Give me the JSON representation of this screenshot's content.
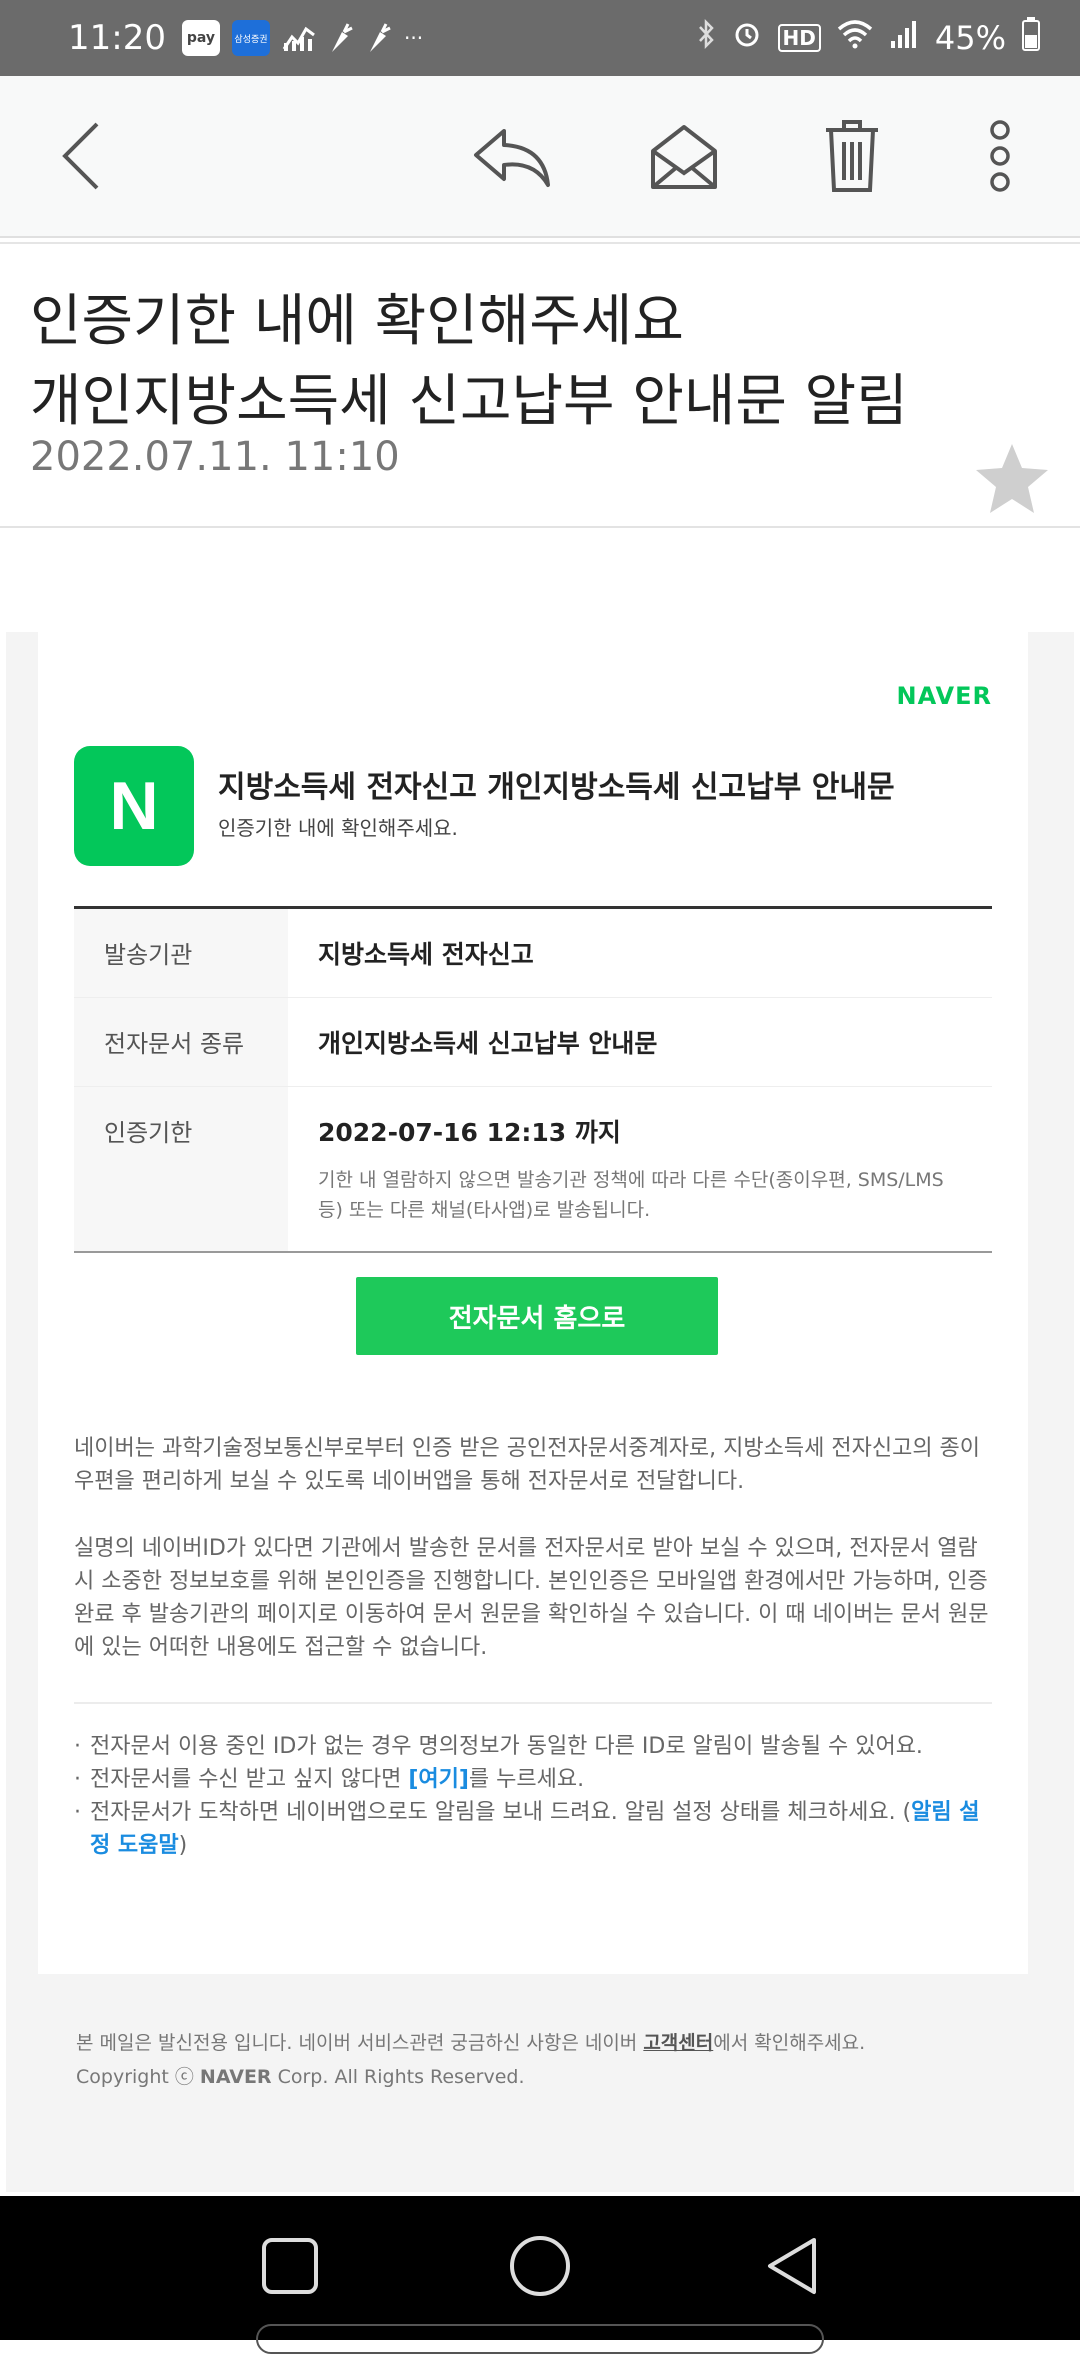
{
  "status_bar": {
    "time": "11:20",
    "pay_label": "pay",
    "samsung_label": "삼성증권",
    "more": "···",
    "battery": "45%",
    "hd_label": "HD"
  },
  "toolbar": {
    "back_icon": "back-arrow-icon",
    "reply_icon": "reply-icon",
    "mark_icon": "envelope-open-icon",
    "delete_icon": "trash-icon",
    "more_icon": "more-vertical-icon"
  },
  "message": {
    "subject_line1": "인증기한 내에 확인해주세요",
    "subject_line2": "개인지방소득세 신고납부 안내문 알림",
    "date": "2022.07.11. 11:10"
  },
  "mail": {
    "brand": "NAVER",
    "badge_letter": "N",
    "title": "지방소득세 전자신고 개인지방소득세 신고납부 안내문",
    "subtitle": "인증기한 내에 확인해주세요.",
    "table": [
      {
        "key": "발송기관",
        "value": "지방소득세 전자신고"
      },
      {
        "key": "전자문서 종류",
        "value": "개인지방소득세 신고납부 안내문"
      },
      {
        "key": "인증기한",
        "value": "2022-07-16 12:13 까지",
        "note": "기한 내 열람하지 않으면 발송기관 정책에 따라 다른 수단(종이우편, SMS/LMS 등) 또는 다른 채널(타사앱)로 발송됩니다."
      }
    ],
    "cta_label": "전자문서 홈으로",
    "desc1": "네이버는 과학기술정보통신부로부터 인증 받은 공인전자문서중계자로, 지방소득세 전자신고의 종이우편을 편리하게 보실 수 있도록 네이버앱을 통해 전자문서로 전달합니다.",
    "desc2": "실명의 네이버ID가 있다면 기관에서 발송한 문서를 전자문서로 받아 보실 수 있으며, 전자문서 열람 시 소중한 정보보호를 위해 본인인증을 진행합니다. 본인인증은 모바일앱 환경에서만 가능하며, 인증 완료 후 발송기관의 페이지로 이동하여 문서 원문을 확인하실 수 있습니다. 이 때 네이버는 문서 원문에 있는 어떠한 내용에도 접근할 수 없습니다.",
    "bullet1": "전자문서 이용 중인 ID가 없는 경우 명의정보가 동일한 다른 ID로 알림이 발송될 수 있어요.",
    "bullet2_pre": "전자문서를 수신 받고 싶지 않다면 ",
    "bullet2_link": "[여기]",
    "bullet2_post": "를 누르세요.",
    "bullet3_pre": "전자문서가 도착하면 네이버앱으로도 알림을 보내 드려요. 알림 설정 상태를 체크하세요. (",
    "bullet3_link": "알림 설정 도움말",
    "bullet3_post": ")",
    "footer_pre": "본 메일은 발신전용 입니다. 네이버 서비스관련 궁금하신 사항은 네이버 ",
    "footer_link": "고객센터",
    "footer_post": "에서 확인해주세요.",
    "copyright_pre": "Copyright ⓒ ",
    "copyright_brand": "NAVER",
    "copyright_post": " Corp. All Rights Reserved."
  },
  "colors": {
    "naver_green": "#03c75a",
    "cta_green": "#1ec95a",
    "link_blue": "#1a8ce0"
  }
}
